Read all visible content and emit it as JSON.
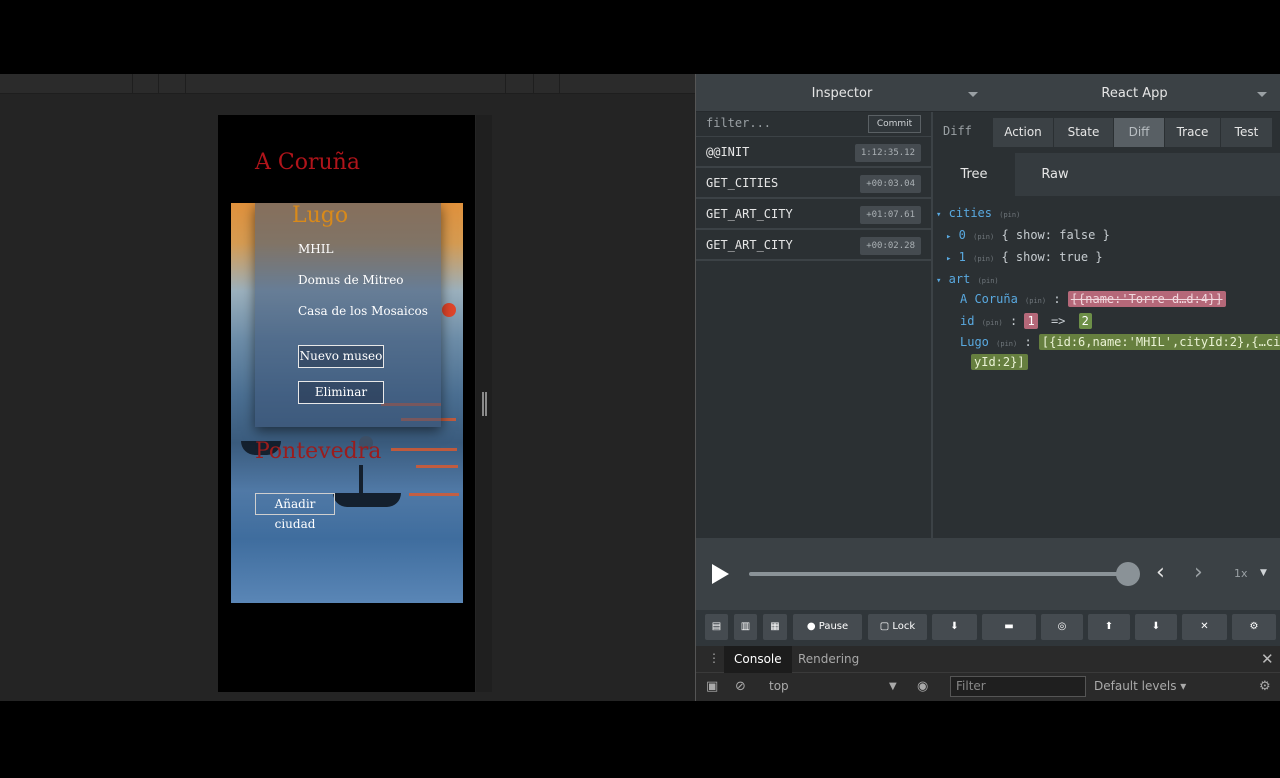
{
  "app": {
    "cities": {
      "coruna": "A Coruña",
      "lugo": "Lugo",
      "pontevedra": "Pontevedra"
    },
    "museums": [
      "MHIL",
      "Domus de Mitreo",
      "Casa de los Mosaicos"
    ],
    "new_museum_label": "Nuevo museo",
    "delete_label": "Eliminar",
    "add_city_label": "Añadir ciudad"
  },
  "devtools": {
    "monitor": "Inspector",
    "instance": "React App",
    "filter_placeholder": "filter...",
    "commit_label": "Commit",
    "actions": [
      {
        "name": "@@INIT",
        "time": "1:12:35.12"
      },
      {
        "name": "GET_CITIES",
        "time": "+00:03.04"
      },
      {
        "name": "GET_ART_CITY",
        "time": "+01:07.61"
      },
      {
        "name": "GET_ART_CITY",
        "time": "+00:02.28"
      }
    ],
    "diff_label": "Diff",
    "tabs": [
      "Action",
      "State",
      "Diff",
      "Trace",
      "Test"
    ],
    "active_tab": "Diff",
    "subtabs": [
      "Tree",
      "Raw"
    ],
    "tree": {
      "cities_key": "cities",
      "item0_key": "0",
      "item0_val": "{ show: false }",
      "item1_key": "1",
      "item1_val": "{ show: true }",
      "art_key": "art",
      "coruna_key": "A Coruña",
      "coruna_old": "[{name:'Torre d…d:4}]",
      "id_key": "id",
      "id_old": "1",
      "id_arrow": "=>",
      "id_new": "2",
      "lugo_key": "Lugo",
      "lugo_val_1": "[{id:6,name:'MHIL',cityId:2},{…ci",
      "lugo_val_2": "yId:2}]",
      "pin": "(pin)"
    },
    "speed": "1x",
    "buttons": {
      "pause": "Pause",
      "lock": "Lock"
    },
    "console": {
      "tabs": [
        "Console",
        "Rendering"
      ],
      "context": "top",
      "filter_placeholder": "Filter",
      "levels": "Default levels ▾"
    }
  }
}
